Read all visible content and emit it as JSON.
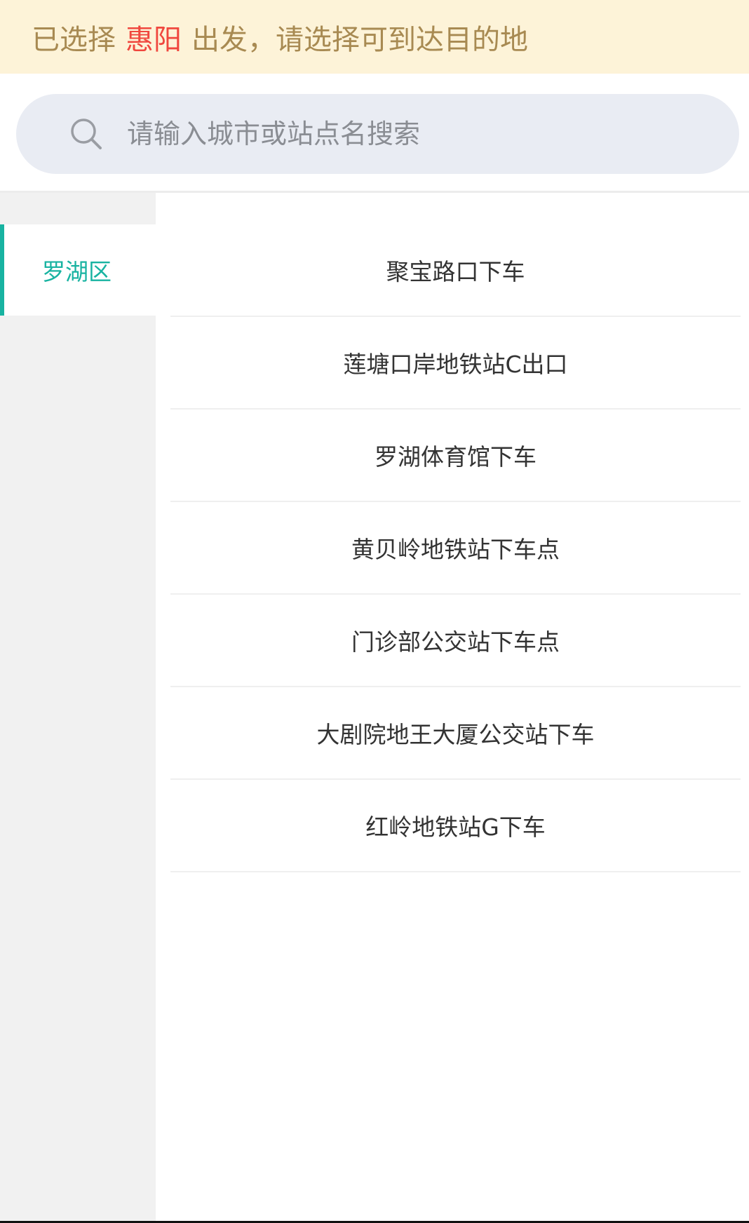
{
  "notice": {
    "prefix": "已选择",
    "city": "惠阳",
    "suffix": "出发，请选择可到达目的地",
    "city_color": "#f0473e"
  },
  "search": {
    "placeholder": "请输入城市或站点名搜索",
    "icon": "search-icon"
  },
  "sidebar": {
    "items": [
      {
        "label": "罗湖区",
        "active": true
      }
    ],
    "accent_color": "#18b3a1"
  },
  "stops": [
    {
      "label": "聚宝路口下车"
    },
    {
      "label": "莲塘口岸地铁站C出口"
    },
    {
      "label": "罗湖体育馆下车"
    },
    {
      "label": "黄贝岭地铁站下车点"
    },
    {
      "label": "门诊部公交站下车点"
    },
    {
      "label": "大剧院地王大厦公交站下车"
    },
    {
      "label": "红岭地铁站G下车"
    }
  ]
}
